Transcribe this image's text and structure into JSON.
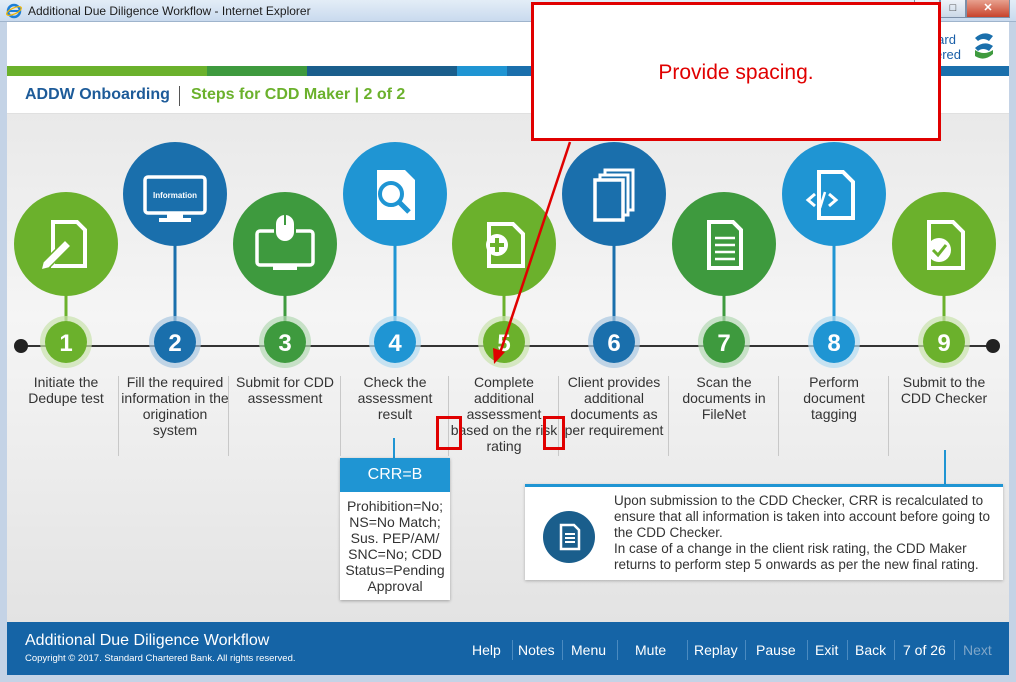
{
  "window": {
    "title": "Additional Due Diligence Workflow - Internet Explorer"
  },
  "brand": {
    "logo_line1": "Standard",
    "logo_line2": "Chartered"
  },
  "header": {
    "breadcrumb_main": "ADDW Onboarding",
    "breadcrumb_sub": "Steps for CDD Maker | 2 of 2"
  },
  "steps": [
    {
      "number": "1",
      "text": "Initiate the Dedupe test",
      "icon": "edit-document-icon",
      "color": "#6bb12c"
    },
    {
      "number": "2",
      "text": "Fill the required information in the origination system",
      "icon": "monitor-information-icon",
      "icon_label": "Information",
      "color": "#1a6fac"
    },
    {
      "number": "3",
      "text": "Submit for CDD assessment",
      "icon": "monitor-mouse-icon",
      "color": "#3e9a3e"
    },
    {
      "number": "4",
      "text": "Check the assessment result",
      "icon": "document-search-icon",
      "color": "#1f95d3"
    },
    {
      "number": "5",
      "text": "Complete additional assessment based on the risk rating",
      "icon": "document-plus-icon",
      "color": "#6bb12c"
    },
    {
      "number": "6",
      "text": "Client provides additional documents as per requirement",
      "icon": "documents-stack-icon",
      "color": "#1a6fac"
    },
    {
      "number": "7",
      "text": "Scan the documents in FileNet",
      "icon": "document-text-icon",
      "color": "#3e9a3e"
    },
    {
      "number": "8",
      "text": "Perform document tagging",
      "icon": "code-document-icon",
      "color": "#1f95d3"
    },
    {
      "number": "9",
      "text": "Submit to the CDD Checker",
      "icon": "document-check-icon",
      "color": "#6bb12c"
    }
  ],
  "crr": {
    "title": "CRR=B",
    "body": "Prohibition=No; NS=No Match; Sus. PEP/AM/ SNC=No; CDD Status=Pending Approval"
  },
  "info": {
    "paragraph1": "Upon submission to the CDD Checker, CRR is recalculated to ensure that all information is taken into account before going to the CDD Checker.",
    "paragraph2": "In case of a change in the client risk rating, the CDD Maker returns to perform step 5 onwards as per the new final rating."
  },
  "callout": {
    "text": "Provide spacing."
  },
  "footer": {
    "title": "Additional Due Diligence Workflow",
    "copyright": "Copyright © 2017. Standard Chartered Bank. All rights reserved.",
    "nav": {
      "help": "Help",
      "notes": "Notes",
      "menu": "Menu",
      "mute": "Mute",
      "replay": "Replay",
      "pause": "Pause",
      "exit": "Exit",
      "back": "Back",
      "page": "7 of 26",
      "next": "Next"
    }
  },
  "colors": {
    "blue_dark": "#1a6fac",
    "blue_light": "#1f95d3",
    "green_light": "#6bb12c",
    "green_dark": "#3e9a3e",
    "footer_blue": "#1564a6",
    "annotation_red": "#e00000"
  }
}
